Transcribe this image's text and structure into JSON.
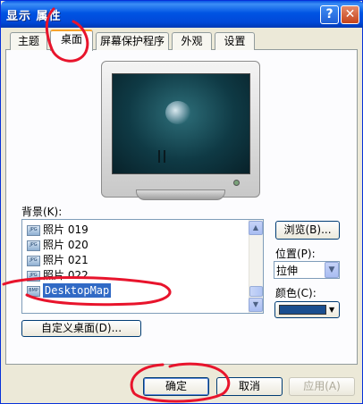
{
  "window": {
    "title": "显示 属性"
  },
  "titlebar_buttons": {
    "help": "?",
    "close": "✕"
  },
  "tabs": [
    {
      "label": "主题",
      "active": false
    },
    {
      "label": "桌面",
      "active": true
    },
    {
      "label": "屏幕保护程序",
      "active": false
    },
    {
      "label": "外观",
      "active": false
    },
    {
      "label": "设置",
      "active": false
    }
  ],
  "background": {
    "label": "背景(K):",
    "items": [
      {
        "icon": "jpeg-icon",
        "label": "照片 019",
        "selected": false
      },
      {
        "icon": "jpeg-icon",
        "label": "照片 020",
        "selected": false
      },
      {
        "icon": "jpeg-icon",
        "label": "照片 021",
        "selected": false
      },
      {
        "icon": "jpeg-icon",
        "label": "照片 022",
        "selected": false
      },
      {
        "icon": "bmp-icon",
        "label": "DesktopMap",
        "selected": true
      }
    ]
  },
  "browse_button": "浏览(B)...",
  "position": {
    "label": "位置(P):",
    "value": "拉伸"
  },
  "color": {
    "label": "颜色(C):",
    "value": "#1a4e8f"
  },
  "custom_desktop_button": "自定义桌面(D)...",
  "buttons": {
    "ok": "确定",
    "cancel": "取消",
    "apply": "应用(A)"
  },
  "annotation_color": "#e8142c"
}
